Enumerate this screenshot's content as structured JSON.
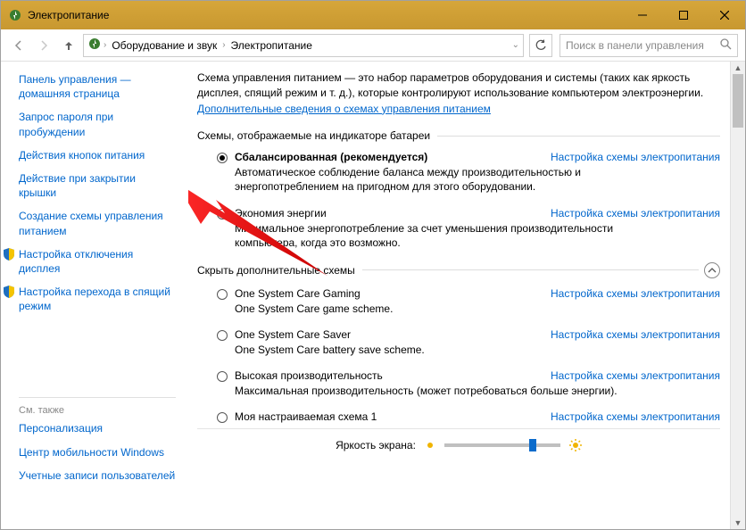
{
  "window": {
    "title": "Электропитание"
  },
  "addressbar": {
    "crumbs": [
      "Оборудование и звук",
      "Электропитание"
    ],
    "search_placeholder": "Поиск в панели управления"
  },
  "sidebar": {
    "items": [
      "Панель управления — домашняя страница",
      "Запрос пароля при пробуждении",
      "Действия кнопок питания",
      "Действие при закрытии крышки",
      "Создание схемы управления питанием",
      "Настройка отключения дисплея",
      "Настройка перехода в спящий режим"
    ],
    "seealso_label": "См. также",
    "seealso": [
      "Персонализация",
      "Центр мобильности Windows",
      "Учетные записи пользователей"
    ]
  },
  "main": {
    "intro_text": "Схема управления питанием — это набор параметров оборудования и системы (таких как яркость дисплея, спящий режим и т. д.), которые контролируют использование компьютером электроэнергии. ",
    "intro_link": "Дополнительные сведения о схемах управления питанием",
    "section1": "Схемы, отображаемые на индикаторе батареи",
    "section2": "Скрыть дополнительные схемы",
    "settings_link": "Настройка схемы электропитания",
    "plans": [
      {
        "name": "Сбалансированная (рекомендуется)",
        "desc": "Автоматическое соблюдение баланса между производительностью и энергопотреблением на пригодном для этого оборудовании.",
        "selected": true,
        "bold": true
      },
      {
        "name": "Экономия энергии",
        "desc": "Минимальное энергопотребление за счет уменьшения производительности компьютера, когда это возможно.",
        "selected": false,
        "bold": false
      }
    ],
    "extra_plans": [
      {
        "name": "One System Care Gaming",
        "desc": "One System Care game scheme."
      },
      {
        "name": "One System Care Saver",
        "desc": "One System Care battery save scheme."
      },
      {
        "name": "Высокая производительность",
        "desc": "Максимальная производительность (может потребоваться больше энергии)."
      },
      {
        "name": "Моя настраиваемая схема 1",
        "desc": ""
      }
    ],
    "brightness_label": "Яркость экрана:"
  }
}
